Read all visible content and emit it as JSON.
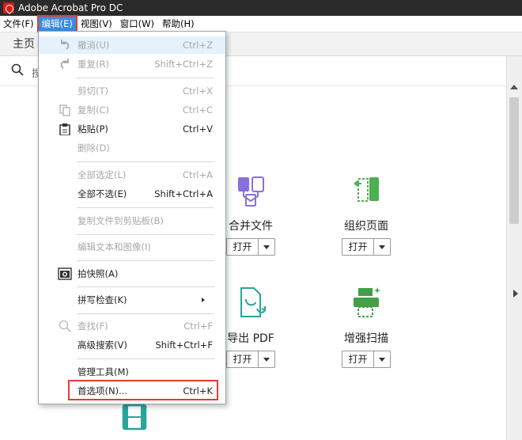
{
  "window": {
    "title": "Adobe Acrobat Pro DC"
  },
  "menubar": {
    "items": [
      {
        "label": "文件(F)"
      },
      {
        "label": "编辑(E)"
      },
      {
        "label": "视图(V)"
      },
      {
        "label": "窗口(W)"
      },
      {
        "label": "帮助(H)"
      }
    ]
  },
  "tabs": {
    "home": "主页"
  },
  "search": {
    "text": "搜"
  },
  "edit_menu": {
    "items": [
      {
        "label": "撤消(U)",
        "shortcut": "Ctrl+Z",
        "icon": "undo-icon",
        "enabled": false
      },
      {
        "label": "重复(R)",
        "shortcut": "Shift+Ctrl+Z",
        "icon": "redo-icon",
        "enabled": false
      },
      {
        "label": "剪切(T)",
        "shortcut": "Ctrl+X",
        "icon": "",
        "enabled": false
      },
      {
        "label": "复制(C)",
        "shortcut": "Ctrl+C",
        "icon": "copy-icon",
        "enabled": false
      },
      {
        "label": "粘贴(P)",
        "shortcut": "Ctrl+V",
        "icon": "paste-icon",
        "enabled": true
      },
      {
        "label": "删除(D)",
        "shortcut": "",
        "icon": "",
        "enabled": false
      },
      {
        "label": "全部选定(L)",
        "shortcut": "Ctrl+A",
        "icon": "",
        "enabled": false
      },
      {
        "label": "全部不选(E)",
        "shortcut": "Shift+Ctrl+A",
        "icon": "",
        "enabled": true
      },
      {
        "label": "复制文件到剪贴板(B)",
        "shortcut": "",
        "icon": "",
        "enabled": false
      },
      {
        "label": "编辑文本和图像(I)",
        "shortcut": "",
        "icon": "",
        "enabled": false
      },
      {
        "label": "拍快照(A)",
        "shortcut": "",
        "icon": "camera-icon",
        "enabled": true
      },
      {
        "label": "拼写检查(K)",
        "shortcut": "",
        "icon": "",
        "enabled": true,
        "submenu": true
      },
      {
        "label": "查找(F)",
        "shortcut": "Ctrl+F",
        "icon": "find-icon",
        "enabled": false
      },
      {
        "label": "高级搜索(V)",
        "shortcut": "Shift+Ctrl+F",
        "icon": "",
        "enabled": true
      },
      {
        "label": "管理工具(M)",
        "shortcut": "",
        "icon": "",
        "enabled": true
      },
      {
        "label": "首选项(N)...",
        "shortcut": "Ctrl+K",
        "icon": "",
        "enabled": true
      }
    ]
  },
  "tools": [
    {
      "name": "合并文件",
      "button": "打开",
      "icon": "combine-files-icon",
      "color": "#8a6fdb"
    },
    {
      "name": "组织页面",
      "button": "打开",
      "icon": "organize-pages-icon",
      "color": "#4caf50"
    },
    {
      "name": "导出 PDF",
      "button": "打开",
      "icon": "export-pdf-icon",
      "color": "#26a69a"
    },
    {
      "name": "增强扫描",
      "button": "打开",
      "icon": "enhance-scan-icon",
      "color": "#43a047"
    },
    {
      "name": "",
      "button": "",
      "icon": "video-icon",
      "color": "#26a69a"
    }
  ],
  "colors": {
    "menu_active": "#3a8de0",
    "highlight": "#e53935"
  }
}
